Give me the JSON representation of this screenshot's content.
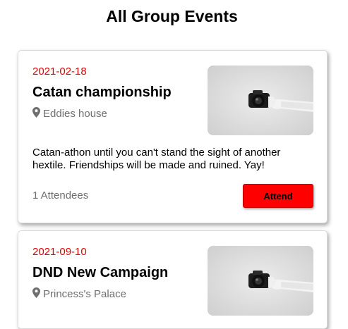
{
  "page": {
    "title": "All Group Events"
  },
  "events": [
    {
      "date": "2021-02-18",
      "title": "Catan championship",
      "location": "Eddies house",
      "description": "Catan-athon until you can't stand the sight of another hextile. Friendships will be made and ruined. Yay!",
      "attendees": "1 Attendees",
      "attend_label": "Attend",
      "image_icon": "camera-in-hand-icon"
    },
    {
      "date": "2021-09-10",
      "title": "DND New Campaign",
      "location": "Princess's Palace",
      "image_icon": "camera-in-hand-icon"
    }
  ],
  "colors": {
    "date": "#e40000",
    "attend_button": "#ff0000",
    "muted_text": "#6f6f6f"
  }
}
